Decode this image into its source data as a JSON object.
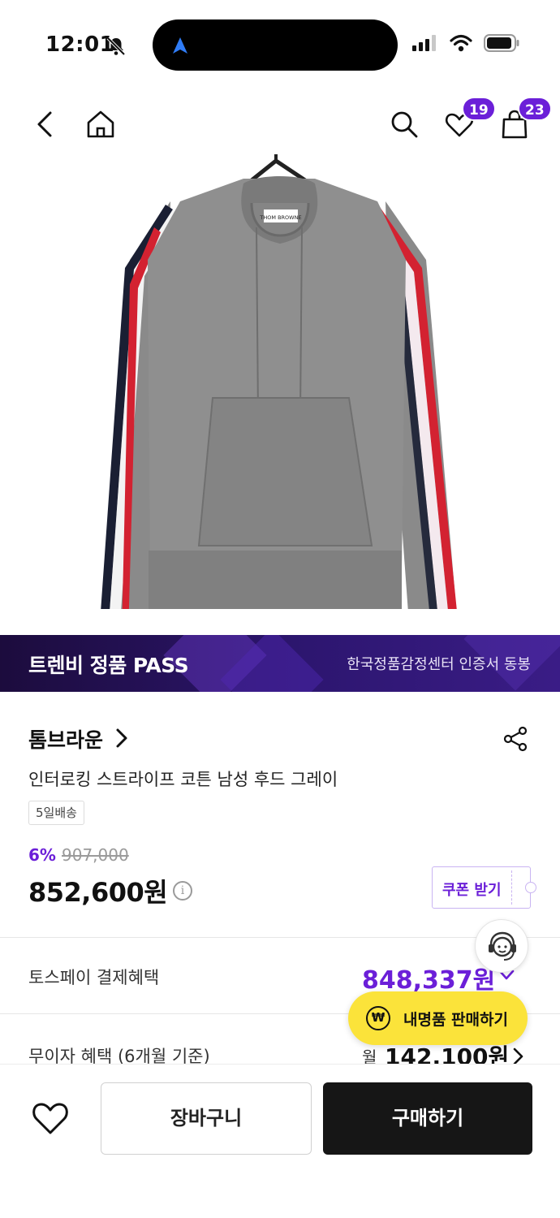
{
  "status_bar": {
    "time": "12:01",
    "icons": [
      "bell-slash-icon",
      "location-arrow-icon",
      "signal-icon",
      "wifi-icon",
      "battery-icon"
    ]
  },
  "nav": {
    "icons": [
      "back-icon",
      "home-icon",
      "search-icon",
      "heart-icon",
      "bag-icon"
    ],
    "wishlist_count": "19",
    "cart_count": "23"
  },
  "product_image": {
    "subject": "hoodie-icon",
    "tag_label": "THOM BROWNE"
  },
  "pass_banner": {
    "title": "트렌비 정품 PASS",
    "subtitle": "한국정품감정센터 인증서 동봉"
  },
  "product": {
    "brand": "톰브라운",
    "name": "인터로킹 스트라이프 코튼 남성 후드 그레이",
    "shipping_tag": "5일배송",
    "discount": "6%",
    "original_price": "907,000",
    "price": "852,600원",
    "info_glyph": "i"
  },
  "coupon": {
    "label": "쿠폰 받기"
  },
  "benefits": {
    "toss_label": "토스페이 결제혜택",
    "toss_value": "848,337원",
    "installment_label": "무이자 혜택 (6개월 기준)",
    "installment_prefix": "월",
    "installment_value": "142,100원"
  },
  "floating": {
    "sell_label": "내명품 판매하기",
    "won_symbol": "₩"
  },
  "bottom_bar": {
    "cart_label": "장바구니",
    "buy_label": "구매하기"
  },
  "colors": {
    "accent": "#6b1fd8",
    "sell_button": "#fbe33a",
    "buy_button": "#161616"
  }
}
